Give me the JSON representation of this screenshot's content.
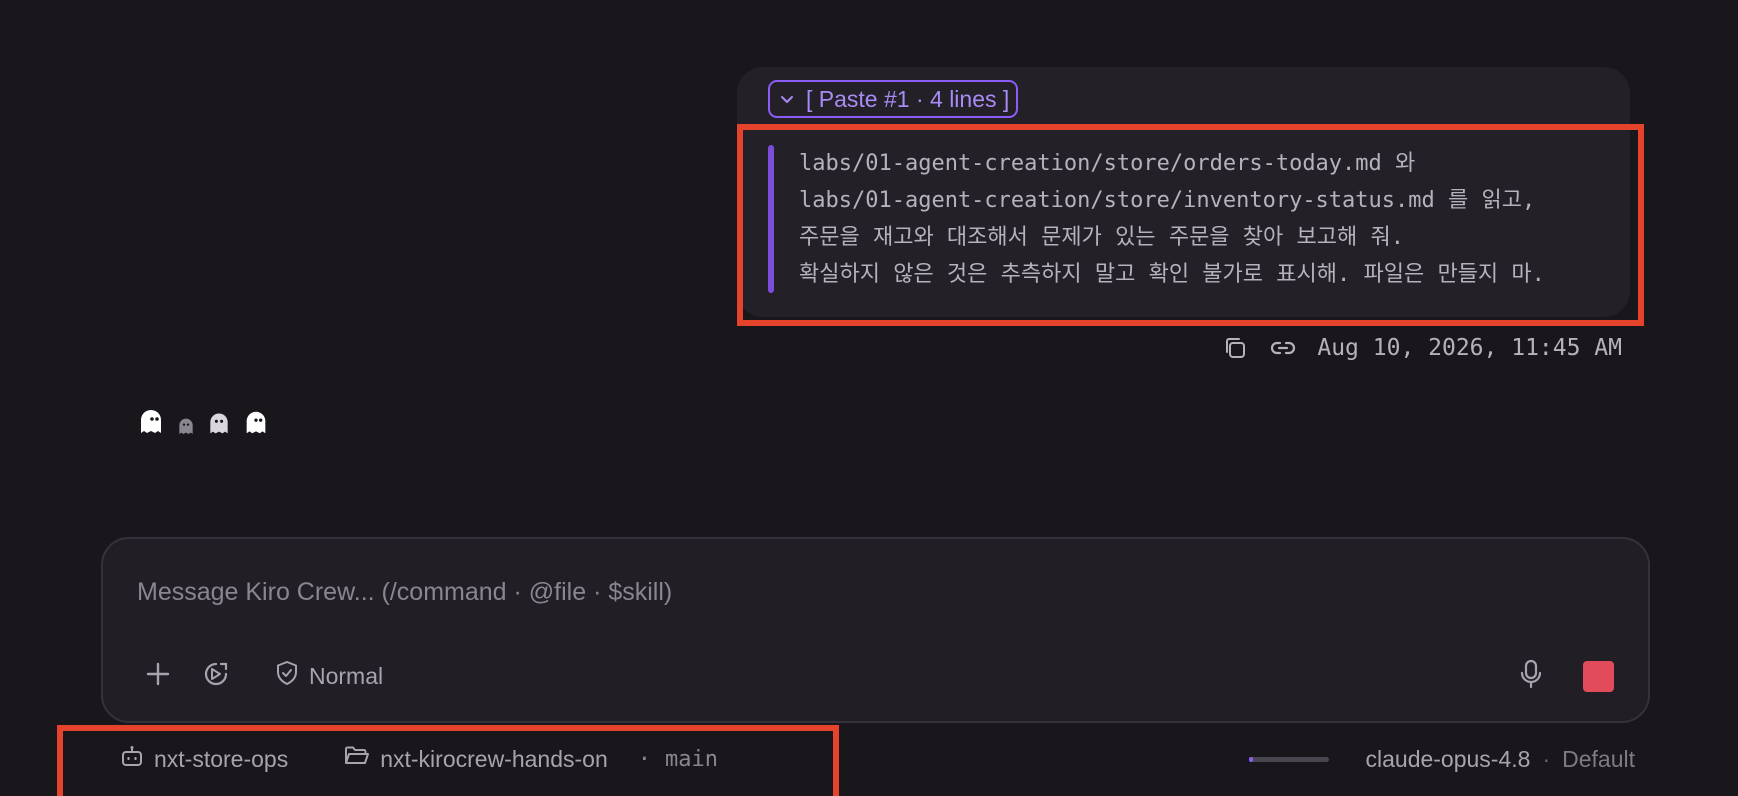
{
  "message": {
    "paste_chip_label": "[ Paste #1 · 4 lines ]",
    "paste_lines": [
      "labs/01-agent-creation/store/orders-today.md 와",
      "labs/01-agent-creation/store/inventory-status.md 를 읽고,",
      "주문을 재고와 대조해서 문제가 있는 주문을 찾아 보고해 줘.",
      "확실하지 않은 것은 추측하지 말고 확인 불가로 표시해. 파일은 만들지 마."
    ],
    "timestamp": "Aug 10, 2026, 11:45 AM",
    "icons": {
      "copy": "copy-icon",
      "link": "link-icon"
    }
  },
  "thinking": {
    "icons": [
      "ghost-icon",
      "ghost-icon",
      "ghost-icon",
      "ghost-icon"
    ]
  },
  "composer": {
    "placeholder": "Message Kiro Crew... (/command · @file · $skill)",
    "value": "",
    "mode_label": "Normal",
    "icons": {
      "add": "plus-icon",
      "tuning": "tuning-icon",
      "mode": "shield-check-icon",
      "mic": "microphone-icon",
      "stop": "stop-icon"
    },
    "colors": {
      "stop": "#e14b5a"
    }
  },
  "status_bar": {
    "agent": "nxt-store-ops",
    "workspace": "nxt-kirocrew-hands-on",
    "branch_separator": "·",
    "branch": "main",
    "context_usage": 0.05,
    "model": "claude-opus-4.8",
    "model_separator": "·",
    "mode": "Default"
  },
  "colors": {
    "background": "#19171c",
    "accent": "#8b5cf6",
    "highlight": "#e5432b"
  }
}
